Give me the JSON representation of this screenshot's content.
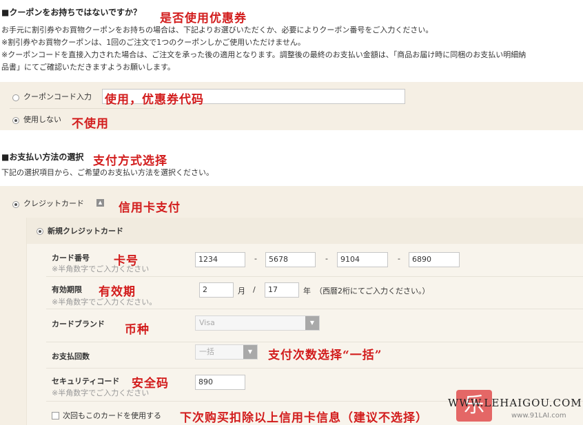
{
  "coupon": {
    "heading": "■クーポンをお持ちではないですか？",
    "heading_anno": "是否使用优惠券",
    "desc1": "お手元に割引券やお買物クーポンをお持ちの場合は、下記よりお選びいただくか、必要によりクーポン番号をご入力ください。",
    "desc2": "※割引券やお買物クーポンは、1回のご注文で1つのクーポンしかご使用いただけません。",
    "desc3": "※クーポンコードを直接入力された場合は、ご注文を承った後の適用となります。調整後の最終のお支払い金額は、「商品お届け時に同梱のお支払い明細納",
    "desc4": "品書」にてご確認いただきますようお願いします。",
    "option_input_label": "クーポンコード入力",
    "option_input_anno": "使用，优惠券代码",
    "option_none_label": "使用しない",
    "option_none_anno": "不使用"
  },
  "payment": {
    "heading": "■お支払い方法の選択",
    "heading_anno": "支付方式选择",
    "desc": "下記の選択項目から、ご希望のお支払い方法を選択ください。",
    "credit_label": "クレジットカード",
    "credit_anno": "信用卡支付",
    "new_card_label": "新規クレジットカード"
  },
  "card_form": {
    "number_label": "カード番号",
    "number_note": "※半角数字でご入力ください",
    "number_anno": "卡号",
    "number_parts": [
      "1234",
      "5678",
      "9104",
      "6890"
    ],
    "dash": "-",
    "expiry_label": "有効期限",
    "expiry_note": "※半角数字でご入力ください。",
    "expiry_anno": "有效期",
    "expiry_month": "2",
    "month_unit": "月",
    "slash": "/",
    "expiry_year": "17",
    "year_unit": "年",
    "year_hint": "（西暦2桁にてご入力ください。）",
    "brand_label": "カードブランド",
    "brand_anno": "币种",
    "brand_value": "Visa",
    "installments_label": "お支払回数",
    "installments_value": "一括",
    "installments_anno": "支付次数选择“一括”",
    "security_label": "セキュリティコード",
    "security_anno": "安全码",
    "security_value": "890",
    "security_note": "※半角数字でご入力ください",
    "save_label": "次回もこのカードを使用する",
    "save_anno": "下次购买扣除以上信用卡信息（建议不选择）"
  },
  "watermark": {
    "text": "WWW.LEHAIGOU.COM",
    "sub": "www.91LAI.com",
    "logo_char": "乐"
  }
}
